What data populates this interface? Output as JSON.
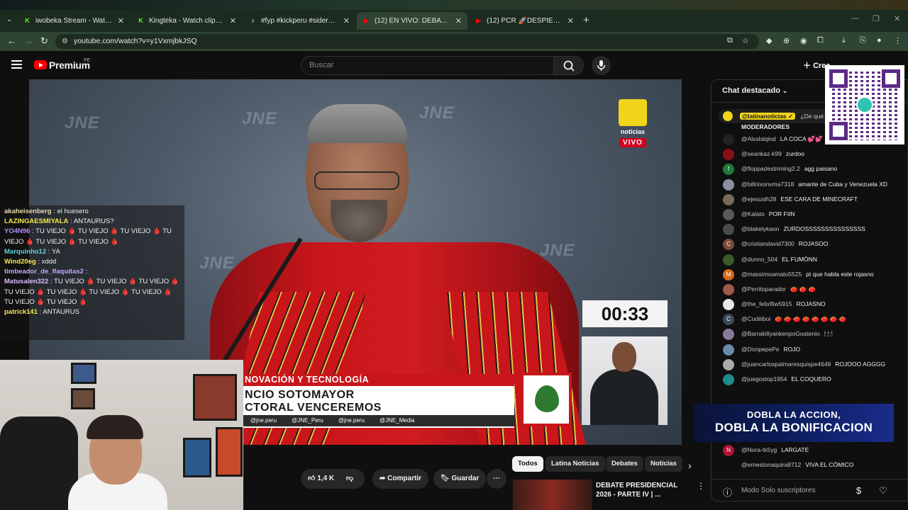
{
  "browser": {
    "tabs": [
      {
        "title": "iwobeka Stream - Watch Live o",
        "favicon": "K",
        "favcolor": "#53fc18"
      },
      {
        "title": "Kingteka - Watch clips on Kick",
        "favicon": "K",
        "favcolor": "#53fc18"
      },
      {
        "title": "#fyp #kickperu #sideral | sidera",
        "favicon": "♪",
        "favcolor": "#ffffff"
      },
      {
        "title": "(12) EN VIVO: DEBATE PRES",
        "favicon": "▶",
        "favcolor": "#ff0000"
      },
      {
        "title": "(12) PCR 🚀DESPIERTA PERU -",
        "favicon": "▶",
        "favcolor": "#ff0000"
      }
    ],
    "url": "youtube.com/watch?v=y1VxmjbkJSQ"
  },
  "youtube": {
    "brand": "Premium",
    "country": "PE",
    "search_placeholder": "Buscar",
    "create_label": "Crea"
  },
  "video": {
    "watermark": "JNE",
    "channel_name": "noticias",
    "live_label": "VIVO",
    "timer": "00:33",
    "lower_third_category": "NOVACIÓN Y TECNOLOGÍA",
    "lower_third_name_1": "NCIO SOTOMAYOR",
    "lower_third_name_2": "CTORAL VENCEREMOS",
    "socials": [
      "@jne.peru",
      "@JNE_Peru",
      "@jne.peru",
      "@JNE_Media"
    ]
  },
  "overlay_chat": [
    {
      "user": "akaheisenberg",
      "color": "#e8d8b0",
      "text": ": el huesero"
    },
    {
      "user": "LAZINGAESMIYALA",
      "color": "#f6e94d",
      "text": ": ANTAURUS?"
    },
    {
      "user": "YO4N96",
      "color": "#b18cff",
      "text": ": TU VIEJO 🩸 TU VIEJO 🩸 TU VIEJO 🩸 TU VIEJO 🩸 TU VIEJO 🩸 TU VIEJO 🩸"
    },
    {
      "user": "Marquinho12",
      "color": "#5fd3e0",
      "text": ": YA"
    },
    {
      "user": "Wind20eg",
      "color": "#f6e94d",
      "text": ": xddd"
    },
    {
      "user": "timbeador_de_flaquitas2",
      "color": "#c8a6ff",
      "text": ":"
    },
    {
      "user": "Matusalen322",
      "color": "#d8c0ff",
      "text": ": TU VIEJO 🩸 TU VIEJO 🩸 TU VIEJO 🩸 TU VIEJO 🩸 TU VIEJO 🩸 TU VIEJO 🩸 TU VIEJO 🩸 TU VIEJO 🩸 TU VIEJO 🩸"
    },
    {
      "user": "patrick141",
      "color": "#f6e94d",
      "text": ": ANTAURUS"
    }
  ],
  "actions": {
    "likes": "1,4 K",
    "share": "Compartir",
    "save": "Guardar"
  },
  "chips": [
    "Todos",
    "Latina Noticias",
    "Debates",
    "Noticias"
  ],
  "recommendation": {
    "title": "DEBATE PRESIDENCIAL 2026 - PARTE IV | ..."
  },
  "chat": {
    "header": "Chat destacado",
    "pinned_user": "@latinanoticias ✓",
    "pinned_text": "¿De qué t",
    "moderators": "MODERADORES",
    "messages": [
      {
        "author": "@Alxslslqind",
        "text": "LA COCA 💕💕",
        "avatar_color": "#222222",
        "initial": ""
      },
      {
        "author": "@seankaz-k99",
        "text": "zurdoo",
        "avatar_color": "#8a0f1a",
        "initial": ""
      },
      {
        "author": "@floppadestriming2.2",
        "text": "agg paisano",
        "avatar_color": "#1e7a3a",
        "initial": "f"
      },
      {
        "author": "@billnixonvma7318",
        "text": "amante de Cuba y Venezuela XD",
        "avatar_color": "#8a8fa0",
        "initial": ""
      },
      {
        "author": "@ejesuslh28",
        "text": "ESE CARA DE MINECRAFT",
        "avatar_color": "#7a6a5a",
        "initial": ""
      },
      {
        "author": "@Kalato",
        "text": "POR FIIN",
        "avatar_color": "#5a5a5a",
        "initial": ""
      },
      {
        "author": "@blakelykaon",
        "text": "ZURDOSSSSSSSSSSSSSSS",
        "avatar_color": "#4a4a4a",
        "initial": ""
      },
      {
        "author": "@cristiandavid7300",
        "text": "ROJASOO",
        "avatar_color": "#7a4a3a",
        "initial": "C"
      },
      {
        "author": "@dunno_504",
        "text": "EL FUMÓNN",
        "avatar_color": "#3a5a2a",
        "initial": ""
      },
      {
        "author": "@massimoamato5525",
        "text": "pt que habla este rojasno",
        "avatar_color": "#d86a1a",
        "initial": "M"
      },
      {
        "author": "@Perritoparador",
        "text": "🍅 🍅 🍅",
        "avatar_color": "#a05a4a",
        "initial": ""
      },
      {
        "author": "@the_felixfliw5915",
        "text": "ROJASNO",
        "avatar_color": "#e8e8e8",
        "initial": ""
      },
      {
        "author": "@Codiiiboi",
        "text": "🍅 🍅 🍅 🍅 🍅 🍅 🍅 🍅",
        "avatar_color": "#3a4a5a",
        "initial": "C"
      },
      {
        "author": "@BarrakillyankenpoGoatenio",
        "text": "🕯 🕯 🕯",
        "avatar_color": "#8a7a9a",
        "initial": ""
      },
      {
        "author": "@DonpepePe",
        "text": "ROJO",
        "avatar_color": "#6a8aaa",
        "initial": ""
      },
      {
        "author": "@juancarlospalmaresquispe4649",
        "text": "ROJOOO AGGGG",
        "avatar_color": "#aaaaaa",
        "initial": ""
      },
      {
        "author": "@juegostop1954",
        "text": "EL COQUERO",
        "avatar_color": "#1f8a8a",
        "initial": ""
      }
    ],
    "late_messages": [
      {
        "author": "@Nora-tk5yg",
        "text": "LARGATE",
        "avatar_color": "#b0123a",
        "initial": "N"
      },
      {
        "author": "@ernestonaquira8712",
        "text": "VIVA EL CÓMICO",
        "avatar_color": "#0f0f0f",
        "initial": ""
      }
    ],
    "footer": "Modo Solo suscriptores"
  },
  "promo": {
    "line1": "DOBLA LA ACCION,",
    "line2": "DOBLA LA BONIFICACION"
  },
  "colors": {
    "yt_red": "#ff0000",
    "accent_red": "#c8161b",
    "latina_yellow": "#f0d51b"
  }
}
